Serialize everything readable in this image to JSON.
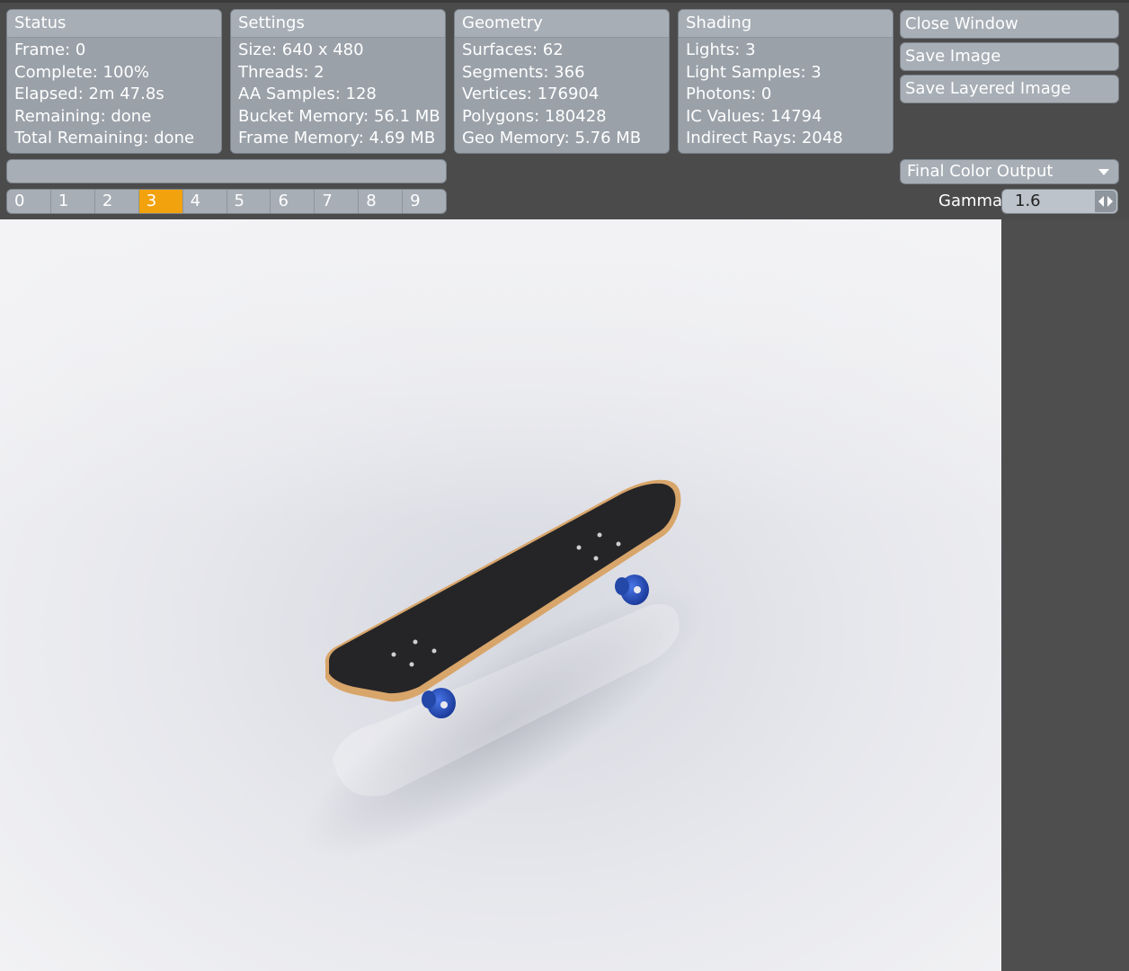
{
  "panels": {
    "status": {
      "title": "Status",
      "lines": [
        "Frame: 0",
        "Complete: 100%",
        "Elapsed: 2m 47.8s",
        "Remaining: done",
        "Total Remaining: done"
      ]
    },
    "settings": {
      "title": "Settings",
      "lines": [
        "Size: 640 x 480",
        "Threads: 2",
        "AA Samples: 128",
        "Bucket Memory: 56.1 MB",
        "Frame Memory: 4.69 MB"
      ]
    },
    "geometry": {
      "title": "Geometry",
      "lines": [
        "Surfaces: 62",
        "Segments: 366",
        "Vertices: 176904",
        "Polygons: 180428",
        "Geo Memory: 5.76 MB"
      ]
    },
    "shading": {
      "title": "Shading",
      "lines": [
        "Lights: 3",
        "Light Samples: 3",
        "Photons: 0",
        "IC Values: 14794",
        "Indirect Rays: 2048"
      ]
    }
  },
  "buttons": {
    "close": "Close Window",
    "save_image": "Save Image",
    "save_layered": "Save Layered Image"
  },
  "frame_buffers": {
    "labels": [
      "0",
      "1",
      "2",
      "3",
      "4",
      "5",
      "6",
      "7",
      "8",
      "9"
    ],
    "active": "3"
  },
  "output_select": {
    "value": "Final Color Output"
  },
  "gamma": {
    "label": "Gamma",
    "value": "1.6"
  },
  "colors": {
    "accent": "#f2a20c",
    "panel": "#a7aeb6",
    "background": "#4b4b4b",
    "deck_grip": "#252527",
    "deck_edge": "#d8a56a",
    "wheels": "#2a55c8"
  },
  "icons": {
    "dropdown": "chevron-down-icon",
    "spinner": "spinner-arrows-icon"
  }
}
